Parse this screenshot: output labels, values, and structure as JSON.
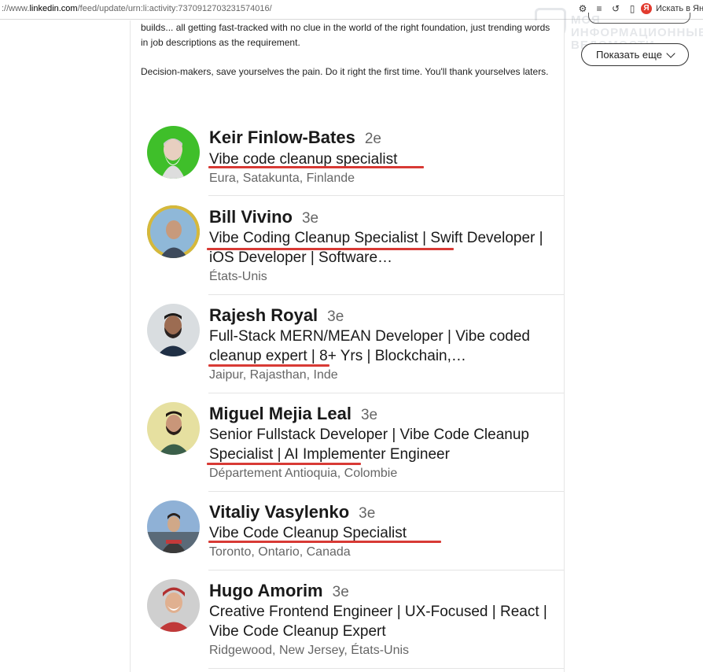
{
  "browser": {
    "url_prefix": "://www.",
    "url_domain": "linkedin.com",
    "url_path": "/feed/update/urn:li:activity:7370912703231574016/",
    "search_label": "Искать в Янд"
  },
  "watermark": {
    "line1": "МОЯ ИНФОРМАЦИОННЫЕ",
    "line2": "ВЕДОМОСТИ"
  },
  "post": {
    "paragraph1": "builds... all getting fast-tracked with no clue in the world of the right foundation, just trending words in job descriptions as the requirement.",
    "paragraph2": "Decision-makers, save yourselves the pain. Do it right the first time. You'll thank yourselves laters."
  },
  "sidebar": {
    "show_more_label": "Показать еще"
  },
  "people": [
    {
      "name": "Keir Finlow-Bates",
      "degree": "2e",
      "headline": "Vibe code cleanup specialist",
      "location": "Eura, Satakunta, Finlande",
      "avatar_color": "#3fbf2a"
    },
    {
      "name": "Bill Vivino",
      "degree": "3e",
      "headline": "Vibe Coding Cleanup Specialist | Swift Developer | iOS Developer | Software…",
      "location": "États-Unis",
      "avatar_color": "#c9a43a"
    },
    {
      "name": "Rajesh Royal",
      "degree": "3e",
      "headline": "Full-Stack MERN/MEAN Developer | Vibe coded cleanup expert | 8+ Yrs | Blockchain,…",
      "location": "Jaipur, Rajasthan, Inde",
      "avatar_color": "#5a4a42"
    },
    {
      "name": "Miguel Mejia Leal",
      "degree": "3e",
      "headline": "Senior Fullstack Developer | Vibe Code Cleanup Specialist | AI Implementer Engineer",
      "location": "Département Antioquia, Colombie",
      "avatar_color": "#d8c95a"
    },
    {
      "name": "Vitaliy Vasylenko",
      "degree": "3e",
      "headline": "Vibe Code Cleanup Specialist",
      "location": "Toronto, Ontario, Canada",
      "avatar_color": "#6f8fb8"
    },
    {
      "name": "Hugo Amorim",
      "degree": "3e",
      "headline": "Creative Frontend Engineer | UX-Focused | React | Vibe Code Cleanup Expert",
      "location": "Ridgewood, New Jersey, États-Unis",
      "avatar_color": "#b03a3a"
    }
  ]
}
